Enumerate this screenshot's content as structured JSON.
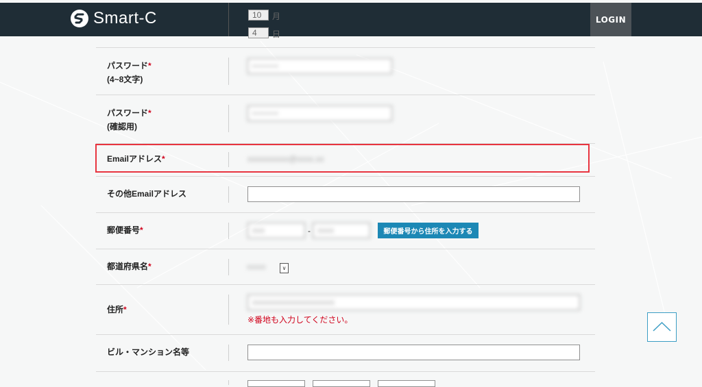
{
  "header": {
    "logo_text": "Smart-C",
    "login_label": "LOGIN",
    "peek_top_value": "10",
    "peek_top_unit": "月",
    "peek_bottom_value": "4",
    "peek_bottom_unit": "日"
  },
  "form": {
    "required_mark": "*",
    "password": {
      "label": "パスワード",
      "sublabel": "(4~8文字)",
      "value": "••••••••"
    },
    "password_confirm": {
      "label": "パスワード",
      "sublabel": "(確認用)",
      "value": "••••••••"
    },
    "email": {
      "label": "Emailアドレス",
      "value": "xxxxxxxxxx@xxxx.xx"
    },
    "other_email": {
      "label": "その他Emailアドレス",
      "value": ""
    },
    "postal_code": {
      "label": "郵便番号",
      "value1": "xxx",
      "separator": "-",
      "value2": "xxxx",
      "lookup_button": "郵便番号から住所を入力する"
    },
    "prefecture": {
      "label": "都道府県名",
      "selected": "xxxxx"
    },
    "address": {
      "label": "住所",
      "value": "xxxxxxxxxxxxxxxxxxxx",
      "note": "※番地も入力してください。"
    },
    "building": {
      "label": "ビル・マンション名等",
      "value": ""
    }
  },
  "colors": {
    "header_bg": "#1f2d36",
    "accent": "#1c88b5",
    "required": "#d0021b",
    "highlight": "#e8343f"
  }
}
